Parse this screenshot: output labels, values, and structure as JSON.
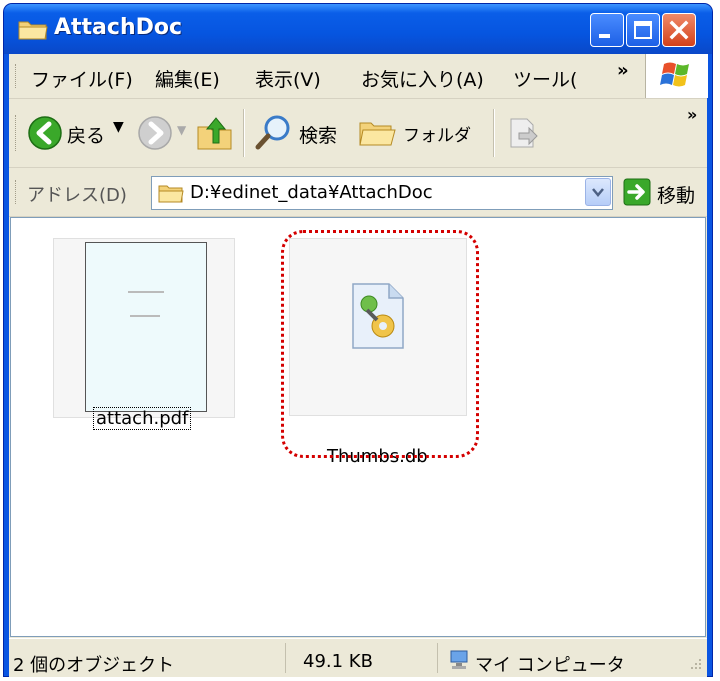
{
  "window": {
    "title": "AttachDoc"
  },
  "menubar": {
    "items": [
      "ファイル(F)",
      "編集(E)",
      "表示(V)",
      "お気に入り(A)",
      "ツール("
    ],
    "overflow": "»"
  },
  "toolbar": {
    "back_label": "戻る",
    "search_label": "検索",
    "folders_label": "フォルダ",
    "overflow": "»"
  },
  "addressbar": {
    "label": "アドレス(D)",
    "path": "D:¥edinet_data¥AttachDoc",
    "go_label": "移動"
  },
  "files": [
    {
      "name": "attach.pdf",
      "type": "pdf",
      "selected": false,
      "focused": true
    },
    {
      "name": "Thumbs.db",
      "type": "system-db",
      "selected": false,
      "focused": false
    }
  ],
  "statusbar": {
    "object_count": "2 個のオブジェクト",
    "size": "49.1 KB",
    "zone": "マイ コンピュータ"
  },
  "colors": {
    "titlebar": "#0a55e2",
    "chrome": "#ece9d8",
    "highlight_ring": "#d40000"
  }
}
